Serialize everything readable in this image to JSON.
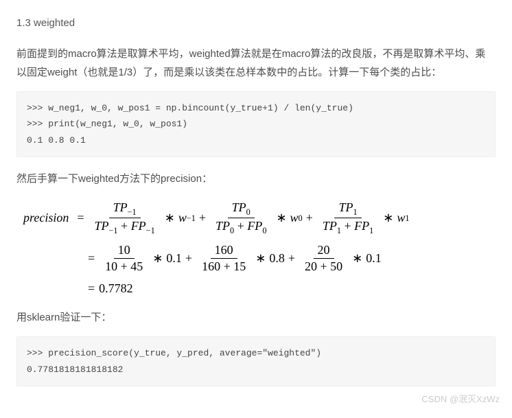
{
  "heading": "1.3 weighted",
  "para1": "前面提到的macro算法是取算术平均，weighted算法就是在macro算法的改良版，不再是取算术平均、乘以固定weight（也就是1/3）了，而是乘以该类在总样本数中的占比。计算一下每个类的占比：",
  "code1": ">>> w_neg1, w_0, w_pos1 = np.bincount(y_true+1) / len(y_true)\n>>> print(w_neg1, w_0, w_pos1)\n0.1 0.8 0.1",
  "para2": "然后手算一下weighted方法下的precision：",
  "math": {
    "lhs": "precision",
    "row1": {
      "f1": {
        "num_var": "TP",
        "num_sub": "−1",
        "den_l": "TP",
        "den_lsub": "−1",
        "den_r": "FP",
        "den_rsub": "−1"
      },
      "w1": {
        "var": "w",
        "sub": "−1"
      },
      "f2": {
        "num_var": "TP",
        "num_sub": "0",
        "den_l": "TP",
        "den_lsub": "0",
        "den_r": "FP",
        "den_rsub": "0"
      },
      "w2": {
        "var": "w",
        "sub": "0"
      },
      "f3": {
        "num_var": "TP",
        "num_sub": "1",
        "den_l": "TP",
        "den_lsub": "1",
        "den_r": "FP",
        "den_rsub": "1"
      },
      "w3": {
        "var": "w",
        "sub": "1"
      }
    },
    "row2": {
      "f1": {
        "num": "10",
        "den": "10 + 45"
      },
      "m1": "0.1",
      "f2": {
        "num": "160",
        "den": "160 + 15"
      },
      "m2": "0.8",
      "f3": {
        "num": "20",
        "den": "20 + 50"
      },
      "m3": "0.1"
    },
    "result": "0.7782"
  },
  "para3": "用sklearn验证一下：",
  "code2": ">>> precision_score(y_true, y_pred, average=\"weighted\")\n0.7781818181818182",
  "watermark": "CSDN @泯灭XzWz"
}
